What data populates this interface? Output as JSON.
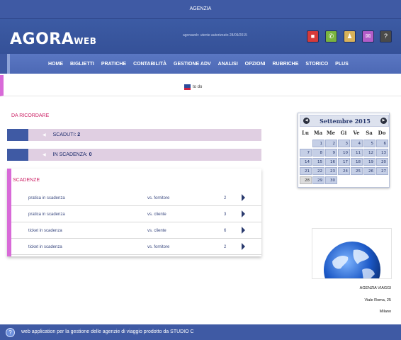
{
  "topbar": {
    "title": "AGENZIA"
  },
  "header": {
    "logo_main": "AGORA",
    "logo_suffix": "WEB",
    "user_info": "agoraweb: utente autorizzato 28/09/2015",
    "buttons": [
      {
        "name": "stop-icon",
        "glyph": "■",
        "color": "#d63a3a"
      },
      {
        "name": "phone-icon",
        "glyph": "✆",
        "color": "#7ab43e"
      },
      {
        "name": "user-icon",
        "glyph": "♟",
        "color": "#d9b25a"
      },
      {
        "name": "mail-icon",
        "glyph": "✉",
        "color": "#b35cc8"
      },
      {
        "name": "help-icon",
        "glyph": "?",
        "color": "#4a4a4a"
      }
    ]
  },
  "nav": {
    "items": [
      "HOME",
      "BIGLIETTI",
      "PRATICHE",
      "CONTABILITÀ",
      "GESTIONE ADV",
      "ANALISI",
      "OPZIONI",
      "RUBRICHE",
      "STORICO",
      "PLUS"
    ]
  },
  "todo": {
    "label": "to do"
  },
  "reminder": {
    "title": "DA RICORDARE",
    "expired_label": "SCADUTI:",
    "expired_count": "2",
    "due_label": "IN SCADENZA:",
    "due_count": "0"
  },
  "deadlines": {
    "title": "SCADENZE",
    "rows": [
      {
        "what": "pratica in scadenza",
        "who": "vs. fornitore",
        "count": "2"
      },
      {
        "what": "pratica in scadenza",
        "who": "vs. cliente",
        "count": "3"
      },
      {
        "what": "ticket in scadenza",
        "who": "vs. cliente",
        "count": "6"
      },
      {
        "what": "ticket in scadenza",
        "who": "vs. fornitore",
        "count": "2"
      }
    ]
  },
  "calendar": {
    "month_label": "Settembre 2015",
    "weekdays": [
      "Lu",
      "Ma",
      "Me",
      "Gi",
      "Ve",
      "Sa",
      "Do"
    ],
    "weeks": [
      [
        "",
        "1",
        "2",
        "3",
        "4",
        "5",
        "6"
      ],
      [
        "7",
        "8",
        "9",
        "10",
        "11",
        "12",
        "13"
      ],
      [
        "14",
        "15",
        "16",
        "17",
        "18",
        "19",
        "20"
      ],
      [
        "21",
        "22",
        "23",
        "24",
        "25",
        "26",
        "27"
      ],
      [
        "28",
        "29",
        "30",
        "",
        "",
        "",
        ""
      ]
    ],
    "today": "28"
  },
  "agency": {
    "name": "AGENZIA VIAGGI",
    "address": "Viale Roma, 25",
    "city": "Milano"
  },
  "footer": {
    "text": "web application per la gestione delle agenzie di viaggio prodotto da STUDIO C"
  }
}
